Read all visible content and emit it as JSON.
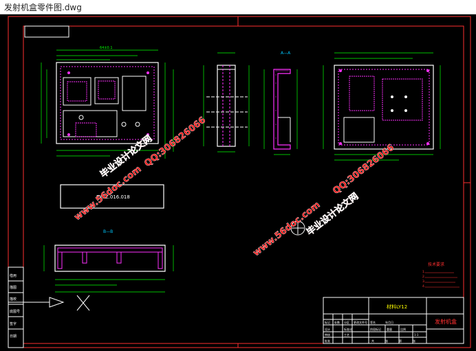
{
  "window": {
    "title": "发射机盒零件图.dwg"
  },
  "drawing": {
    "section_aa_label": "A—A",
    "section_bb_label": "B—B",
    "part_code": "FXFZ.016.018",
    "material": "材料LY12",
    "part_name": "发射机盒",
    "tech_req_title": "技术要求",
    "tech_req_lines": [
      "1.",
      "2.",
      "3.",
      "4."
    ],
    "title_block_cells": [
      "标记",
      "处数",
      "分区",
      "更改文件号",
      "签名",
      "年月日",
      "设计",
      "标准化",
      "阶段标记",
      "重量",
      "比例",
      "审核",
      "工艺",
      "批准",
      "共",
      "张",
      "第",
      "张"
    ],
    "side_labels": [
      "借用",
      "描图",
      "描校",
      "底图号",
      "签字",
      "日期"
    ],
    "dim_top_width": "64±0.1",
    "scale_value": "1:1"
  },
  "watermarks": [
    {
      "text": "毕业设计论文网"
    },
    {
      "text": "www.56doc.com"
    },
    {
      "text": "QQ:306826066"
    },
    {
      "text": "毕业设计论文网"
    },
    {
      "text": "www.56doc.com"
    },
    {
      "text": "QQ:306826066"
    }
  ],
  "colors": {
    "background": "#000000",
    "frame": "#ff3030",
    "outline": "#ffffff",
    "dim": "#00ff00",
    "cyan": "#00c8ff",
    "hatch": "#ff30ff",
    "watermark": "#ff1010"
  }
}
